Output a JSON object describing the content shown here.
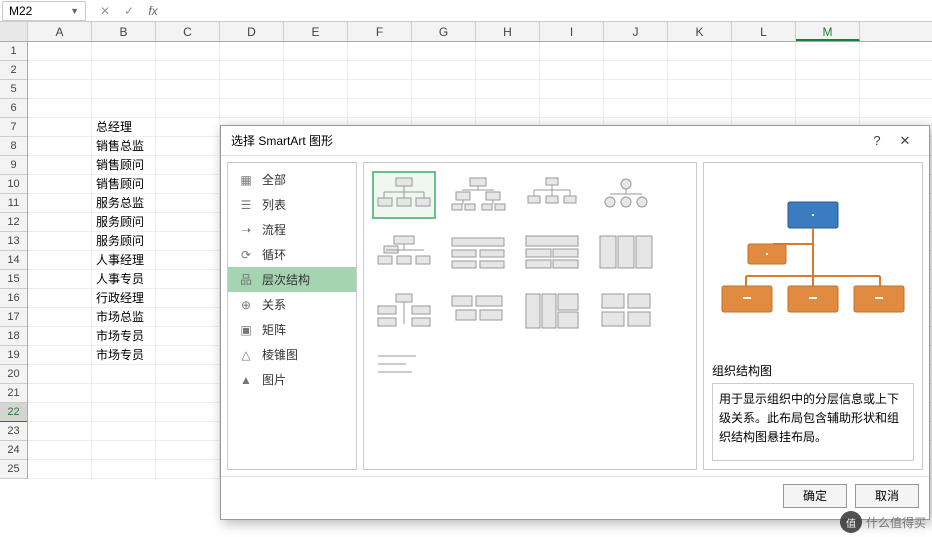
{
  "namebox": {
    "value": "M22"
  },
  "columns": [
    "A",
    "B",
    "C",
    "D",
    "E",
    "F",
    "G",
    "H",
    "I",
    "J",
    "K",
    "L",
    "M"
  ],
  "rows": [
    "1",
    "2",
    "5",
    "6",
    "7",
    "8",
    "9",
    "10",
    "11",
    "12",
    "13",
    "14",
    "15",
    "16",
    "17",
    "18",
    "19",
    "20",
    "21",
    "22",
    "23",
    "24",
    "25"
  ],
  "selected_row": "22",
  "selected_col_index": 12,
  "data_cells": {
    "col": 1,
    "start_row_label": "7",
    "values": [
      "总经理",
      "销售总监",
      "销售顾问",
      "销售顾问",
      "服务总监",
      "服务顾问",
      "服务顾问",
      "人事经理",
      "人事专员",
      "行政经理",
      "市场总监",
      "市场专员",
      "市场专员"
    ]
  },
  "dialog": {
    "title": "选择 SmartArt 图形",
    "categories": [
      "全部",
      "列表",
      "流程",
      "循环",
      "层次结构",
      "关系",
      "矩阵",
      "棱锥图",
      "图片"
    ],
    "selected_category": "层次结构",
    "preview_name": "组织结构图",
    "preview_desc": "用于显示组织中的分层信息或上下级关系。此布局包含辅助形状和组织结构图悬挂布局。",
    "ok": "确定",
    "cancel": "取消"
  },
  "watermark": "什么值得买"
}
